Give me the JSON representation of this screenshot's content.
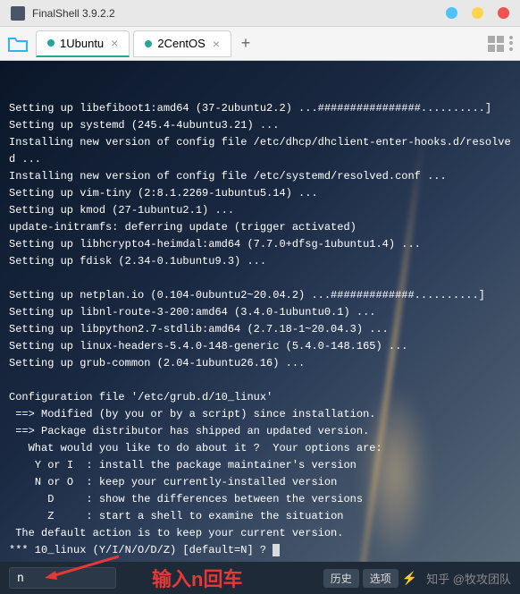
{
  "titlebar": {
    "title": "FinalShell 3.9.2.2"
  },
  "tabs": [
    {
      "index": "1",
      "label": "Ubuntu",
      "active": true
    },
    {
      "index": "2",
      "label": "CentOS",
      "active": false
    }
  ],
  "terminal_lines": [
    "Setting up libefiboot1:amd64 (37-2ubuntu2.2) ...################..........]",
    "Setting up systemd (245.4-4ubuntu3.21) ...",
    "Installing new version of config file /etc/dhcp/dhclient-enter-hooks.d/resolved ...",
    "Installing new version of config file /etc/systemd/resolved.conf ...",
    "Setting up vim-tiny (2:8.1.2269-1ubuntu5.14) ...",
    "Setting up kmod (27-1ubuntu2.1) ...",
    "update-initramfs: deferring update (trigger activated)",
    "Setting up libhcrypto4-heimdal:amd64 (7.7.0+dfsg-1ubuntu1.4) ...",
    "Setting up fdisk (2.34-0.1ubuntu9.3) ...",
    "",
    "Setting up netplan.io (0.104-0ubuntu2~20.04.2) ...#############..........]",
    "Setting up libnl-route-3-200:amd64 (3.4.0-1ubuntu0.1) ...",
    "Setting up libpython2.7-stdlib:amd64 (2.7.18-1~20.04.3) ...",
    "Setting up linux-headers-5.4.0-148-generic (5.4.0-148.165) ...",
    "Setting up grub-common (2.04-1ubuntu26.16) ...",
    "",
    "Configuration file '/etc/grub.d/10_linux'",
    " ==> Modified (by you or by a script) since installation.",
    " ==> Package distributor has shipped an updated version.",
    "   What would you like to do about it ?  Your options are:",
    "    Y or I  : install the package maintainer's version",
    "    N or O  : keep your currently-installed version",
    "      D     : show the differences between the versions",
    "      Z     : start a shell to examine the situation",
    " The default action is to keep your current version.",
    "*** 10_linux (Y/I/N/O/D/Z) [default=N] ? "
  ],
  "input": {
    "value": "n"
  },
  "hint": "输入n回车",
  "buttons": {
    "history": "历史",
    "options": "选项"
  },
  "watermark": "知乎 @牧攻团队"
}
